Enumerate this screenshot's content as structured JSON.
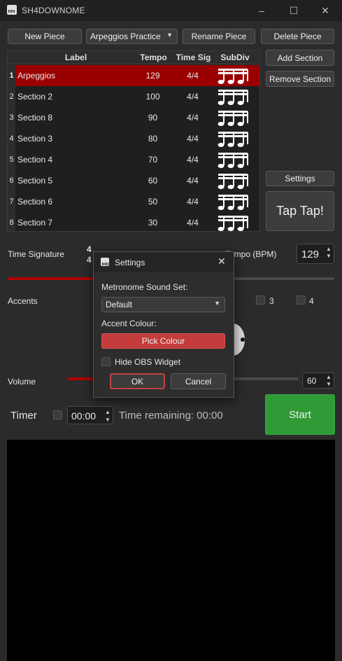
{
  "window": {
    "title": "SH4DOWNOME"
  },
  "toolbar": {
    "new_piece": "New Piece",
    "piece_select": "Arpeggios Practice",
    "rename_piece": "Rename Piece",
    "delete_piece": "Delete Piece"
  },
  "table": {
    "headers": {
      "label": "Label",
      "tempo": "Tempo",
      "time_sig": "Time Sig",
      "subdiv": "SubDiv"
    },
    "rows": [
      {
        "num": "1",
        "label": "Arpeggios",
        "tempo": "129",
        "time_sig": "4/4"
      },
      {
        "num": "2",
        "label": "Section 2",
        "tempo": "100",
        "time_sig": "4/4"
      },
      {
        "num": "3",
        "label": "Section 8",
        "tempo": "90",
        "time_sig": "4/4"
      },
      {
        "num": "4",
        "label": "Section 3",
        "tempo": "80",
        "time_sig": "4/4"
      },
      {
        "num": "5",
        "label": "Section 4",
        "tempo": "70",
        "time_sig": "4/4"
      },
      {
        "num": "6",
        "label": "Section 5",
        "tempo": "60",
        "time_sig": "4/4"
      },
      {
        "num": "7",
        "label": "Section 6",
        "tempo": "50",
        "time_sig": "4/4"
      },
      {
        "num": "8",
        "label": "Section 7",
        "tempo": "30",
        "time_sig": "4/4"
      }
    ]
  },
  "side": {
    "add_section": "Add Section",
    "remove_section": "Remove Section",
    "settings": "Settings",
    "tap": "Tap Tap!"
  },
  "controls": {
    "time_signature_label": "Time Signature",
    "ts_top": "4",
    "ts_bottom": "4",
    "tempo_label": "Tempo (BPM)",
    "tempo_value": "129",
    "accents_label": "Accents",
    "accent_3": "3",
    "accent_4": "4",
    "volume_label": "Volume",
    "volume_value": "60",
    "timer_label": "Timer",
    "timer_value": "00:00",
    "time_remaining": "Time remaining: 00:00",
    "start": "Start"
  },
  "dialog": {
    "title": "Settings",
    "sound_set_label": "Metronome Sound Set:",
    "sound_set_value": "Default",
    "accent_colour_label": "Accent Colour:",
    "pick_colour": "Pick Colour",
    "hide_obs_label": "Hide OBS Widget",
    "ok": "OK",
    "cancel": "Cancel"
  },
  "colors": {
    "accent": "#9b0000",
    "start_green": "#2f9a36",
    "pick_colour_red": "#c43c3c"
  }
}
